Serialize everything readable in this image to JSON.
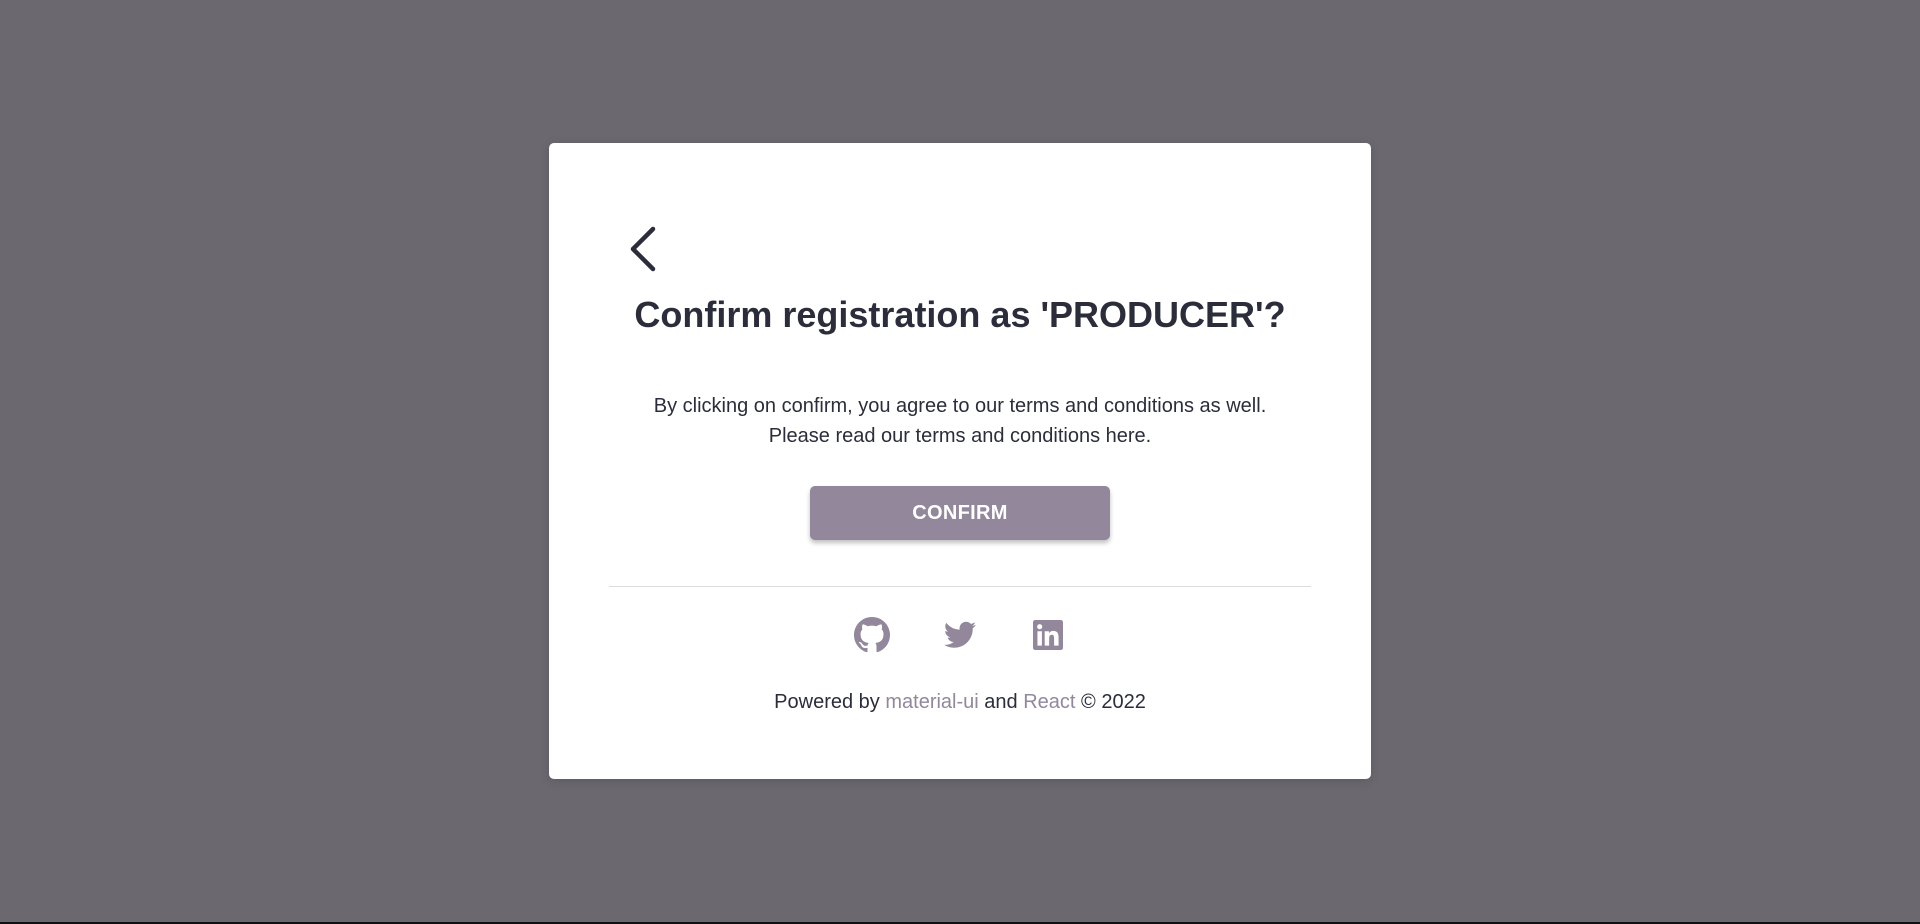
{
  "colors": {
    "overlay": "#6b6870",
    "accent": "#92879b",
    "text": "#2b2d3a",
    "card": "#ffffff"
  },
  "dialog": {
    "back_icon": "chevron-left-icon",
    "title": "Confirm registration as 'PRODUCER'?",
    "description_line1": "By clicking on confirm, you agree to our terms and conditions as well.",
    "description_line2": "Please read our terms and conditions here.",
    "confirm_label": "CONFIRM"
  },
  "social": {
    "icons": [
      "github-icon",
      "twitter-icon",
      "linkedin-icon"
    ]
  },
  "footer": {
    "prefix": "Powered by",
    "link1": "material-ui",
    "middle": "and",
    "link2": "React",
    "suffix": "© 2022"
  }
}
